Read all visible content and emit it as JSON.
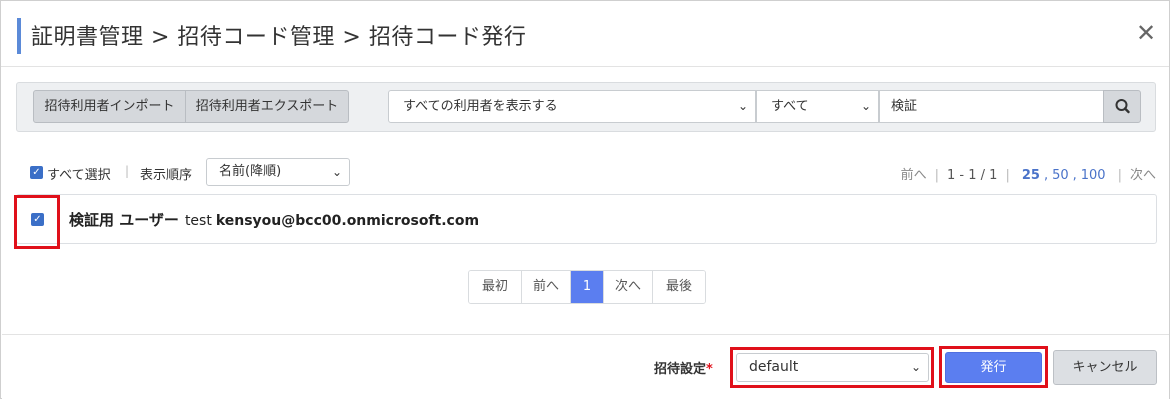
{
  "header": {
    "title": "証明書管理 > 招待コード管理 > 招待コード発行",
    "close_icon": "close-icon"
  },
  "toolbar": {
    "import_label": "招待利用者インポート",
    "export_label": "招待利用者エクスポート",
    "user_filter": "すべての利用者を表示する",
    "status_filter": "すべて",
    "search_value": "検証",
    "search_icon": "search-icon"
  },
  "list_controls": {
    "select_all_label": "すべて選択",
    "sort_label": "表示順序",
    "sort_value": "名前(降順)"
  },
  "pager_top": {
    "prev": "前へ",
    "range": "1 - 1 / 1",
    "sizes": [
      "25",
      "50",
      "100"
    ],
    "next": "次へ"
  },
  "rows": [
    {
      "checked": true,
      "name": "検証用 ユーザー",
      "user_id": "test",
      "email": "kensyou@bcc00.onmicrosoft.com"
    }
  ],
  "pagination": {
    "first": "最初",
    "prev": "前へ",
    "current": "1",
    "next": "次へ",
    "last": "最後"
  },
  "footer": {
    "setting_label": "招待設定",
    "required_mark": "*",
    "setting_value": "default",
    "issue_label": "発行",
    "cancel_label": "キャンセル"
  },
  "colors": {
    "accent": "#5b7ef0",
    "title_bar": "#5b8ad8",
    "highlight": "#e0101a",
    "checkbox": "#3b6fc7"
  }
}
